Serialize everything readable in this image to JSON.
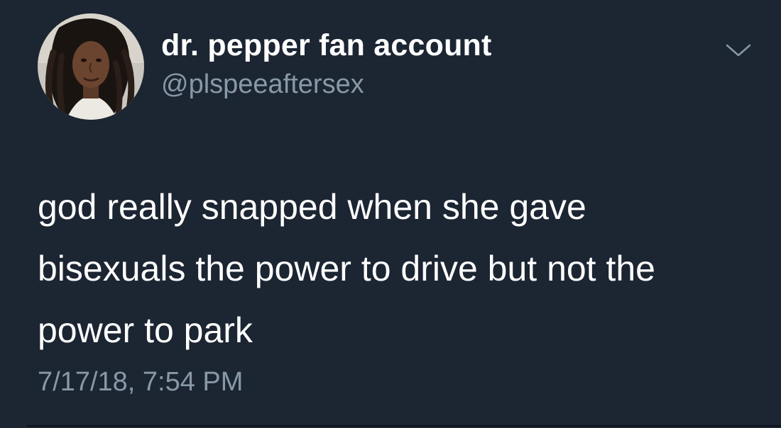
{
  "tweet": {
    "author": {
      "display_name": "dr. pepper fan account",
      "handle": "@plspeeaftersex",
      "avatar_icon": "profile-photo"
    },
    "menu_icon": "chevron-down-icon",
    "text_lines": [
      "god really snapped when she gave",
      "bisexuals the power to drive but not the",
      "power to park"
    ],
    "timestamp": "7/17/18, 7:54 PM"
  },
  "colors": {
    "background": "#1c2532",
    "primary_text": "#ffffff",
    "secondary_text": "#8899a6"
  }
}
